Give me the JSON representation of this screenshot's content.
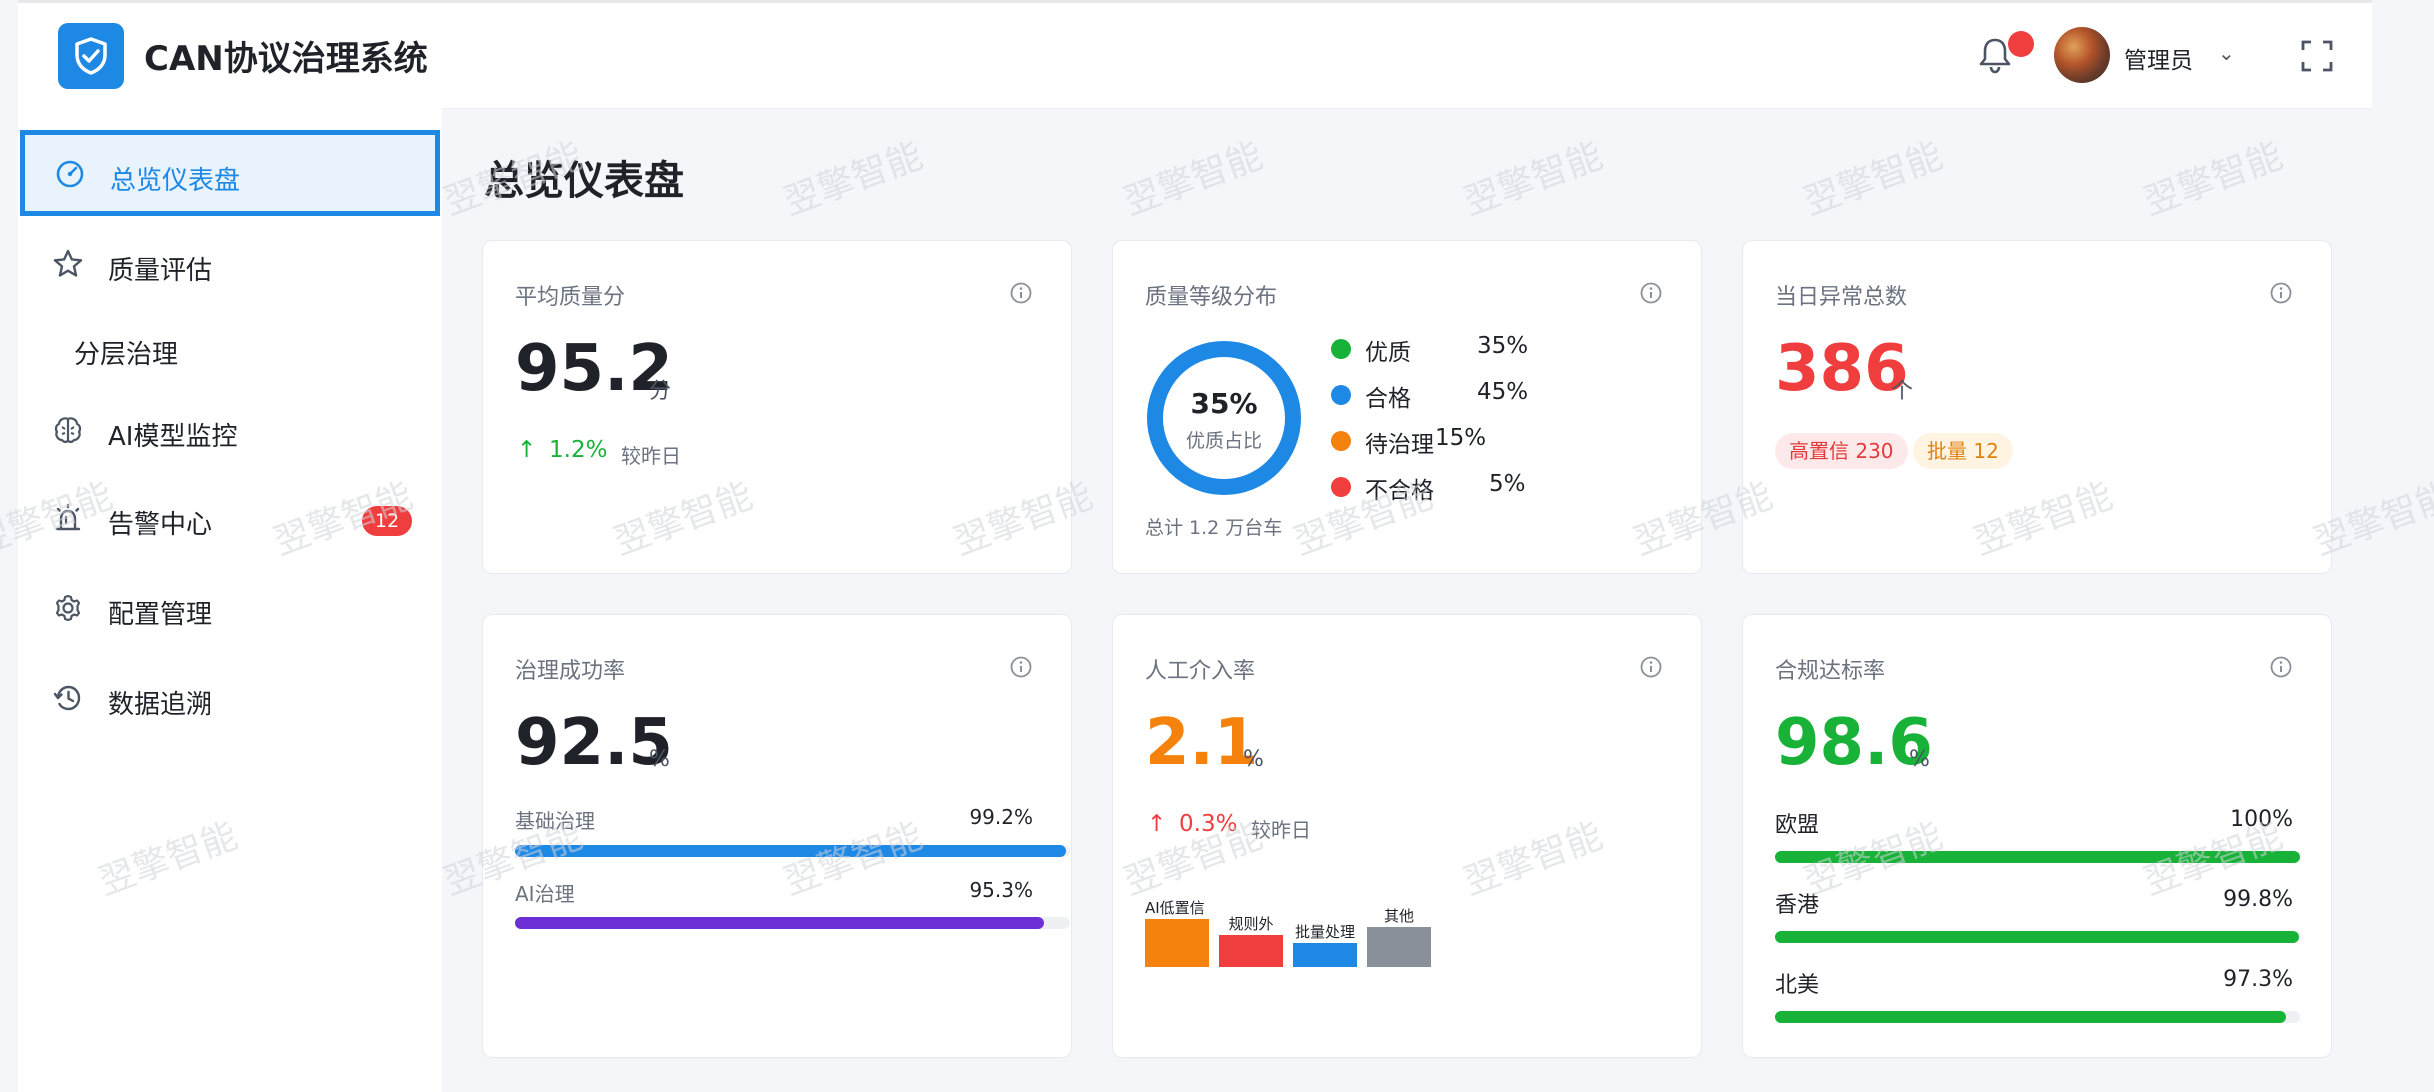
{
  "app": {
    "title": "CAN协议治理系统"
  },
  "header": {
    "user_name": "管理员",
    "chevron": "⌄"
  },
  "sidebar": {
    "items": [
      {
        "label": "总览仪表盘",
        "icon": "dashboard-gauge-icon",
        "active": true
      },
      {
        "label": "质量评估",
        "icon": "star-icon"
      },
      {
        "label": "分层治理",
        "icon": ""
      },
      {
        "label": "AI模型监控",
        "icon": "brain-icon"
      },
      {
        "label": "告警中心",
        "icon": "alarm-icon",
        "badge": "12"
      },
      {
        "label": "配置管理",
        "icon": "gear-icon"
      },
      {
        "label": "数据追溯",
        "icon": "history-icon"
      }
    ]
  },
  "main": {
    "page_title": "总览仪表盘"
  },
  "cards": {
    "avg_quality": {
      "title": "平均质量分",
      "value": "95.2",
      "unit": "分",
      "trend_arrow": "↑",
      "trend": "1.2%",
      "compare": "较昨日"
    },
    "grade_dist": {
      "title": "质量等级分布",
      "donut_value": "35%",
      "donut_label": "优质占比",
      "donut_fraction": 0.35,
      "total": "总计 1.2 万台车",
      "legend": [
        {
          "name": "优质",
          "value": "35%",
          "color": "#17b237"
        },
        {
          "name": "合格",
          "value": "45%",
          "color": "#1e88e5"
        },
        {
          "name": "待治理",
          "value": "15%",
          "color": "#f5820d"
        },
        {
          "name": "不合格",
          "value": "5%",
          "color": "#f03e3e"
        }
      ]
    },
    "daily_anomaly": {
      "title": "当日异常总数",
      "value": "386",
      "unit": "个",
      "tag_high": "高置信 230",
      "tag_batch": "批量 12"
    },
    "gov_success": {
      "title": "治理成功率",
      "value": "92.5",
      "unit": "%",
      "bars": [
        {
          "label": "基础治理",
          "value": "99.2%",
          "fraction": 0.992,
          "color": "#1e88e5"
        },
        {
          "label": "AI治理",
          "value": "95.3%",
          "fraction": 0.953,
          "color": "#6d2fd6"
        }
      ]
    },
    "manual_rate": {
      "title": "人工介入率",
      "value": "2.1",
      "unit": "%",
      "trend_arrow": "↑",
      "trend": "0.3%",
      "compare": "较昨日",
      "mini_bars": [
        {
          "label": "AI低置信",
          "level": 1.0,
          "color": "#f5820d"
        },
        {
          "label": "规则外",
          "level": 0.67,
          "color": "#f03e3e"
        },
        {
          "label": "批量处理",
          "level": 0.5,
          "color": "#1e88e5"
        },
        {
          "label": "其他",
          "level": 0.83,
          "color": "#8a9099"
        }
      ]
    },
    "compliance": {
      "title": "合规达标率",
      "value": "98.6",
      "unit": "%",
      "bars": [
        {
          "label": "欧盟",
          "value": "100%",
          "fraction": 1.0,
          "color": "#17b237"
        },
        {
          "label": "香港",
          "value": "99.8%",
          "fraction": 0.998,
          "color": "#17b237"
        },
        {
          "label": "北美",
          "value": "97.3%",
          "fraction": 0.973,
          "color": "#17b237"
        }
      ]
    }
  },
  "colors": {
    "primary": "#1e88e5",
    "success": "#17b237",
    "danger": "#f03e3e",
    "warning": "#f5820d"
  },
  "watermark": "翌擎智能"
}
